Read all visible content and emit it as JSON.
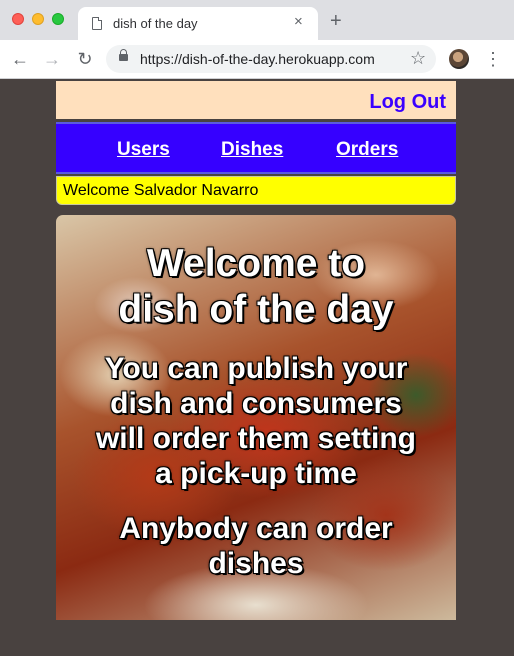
{
  "browser": {
    "tab_title": "dish of the day",
    "tab_close_glyph": "×",
    "new_tab_glyph": "+",
    "url": "https://dish-of-the-day.herokuapp.com",
    "back_glyph": "←",
    "forward_glyph": "→",
    "reload_glyph": "↻",
    "star_glyph": "☆",
    "menu_glyph": "⋮"
  },
  "header": {
    "logout_label": "Log Out"
  },
  "nav": {
    "items": [
      {
        "label": "Users"
      },
      {
        "label": "Dishes"
      },
      {
        "label": "Orders"
      }
    ]
  },
  "welcome": {
    "text": "Welcome Salvador Navarro"
  },
  "hero": {
    "title_line1": "Welcome to",
    "title_line2": "dish of the day",
    "subtitle_line1": "You can publish your",
    "subtitle_line2": "dish and consumers",
    "subtitle_line3": "will order them setting",
    "subtitle_line4": "a pick-up time",
    "note_line1": "Anybody can order",
    "note_line2": "dishes"
  },
  "colors": {
    "page_background": "#494240",
    "header_background": "#ffe0bd",
    "nav_background": "#3600ff",
    "welcome_background": "#ffff00",
    "logout_color": "#3a00ff"
  },
  "icons": {
    "tab": "page-icon",
    "secure": "lock-icon",
    "bookmark": "star-icon",
    "profile": "avatar"
  }
}
